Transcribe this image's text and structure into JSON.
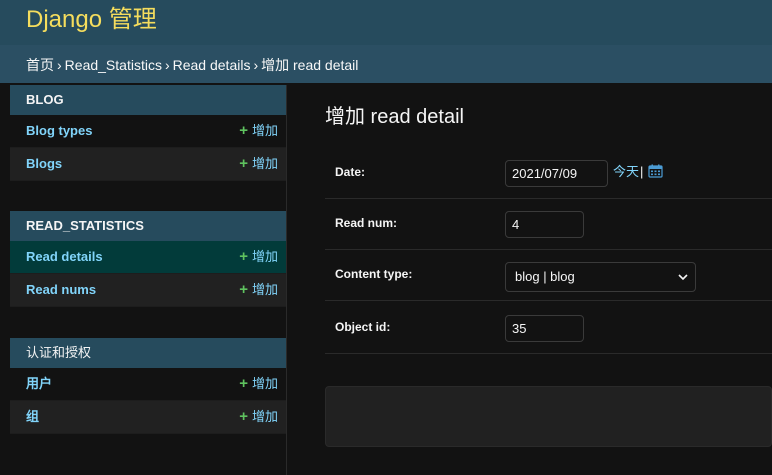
{
  "header": {
    "brand": "Django 管理"
  },
  "breadcrumbs": {
    "home": "首页",
    "app": "Read_Statistics",
    "model": "Read details",
    "current": "增加 read detail",
    "sep": "›"
  },
  "sidebar": {
    "modules": [
      {
        "caption": "BLOG",
        "items": [
          {
            "label": "Blog types",
            "add": "增加"
          },
          {
            "label": "Blogs",
            "add": "增加"
          }
        ]
      },
      {
        "caption": "READ_STATISTICS",
        "items": [
          {
            "label": "Read details",
            "add": "增加"
          },
          {
            "label": "Read nums",
            "add": "增加"
          }
        ]
      },
      {
        "caption": "认证和授权",
        "items": [
          {
            "label": "用户",
            "add": "增加"
          },
          {
            "label": "组",
            "add": "增加"
          }
        ]
      }
    ],
    "add_glyph": "+"
  },
  "content": {
    "title": "增加 read detail",
    "fields": {
      "date": {
        "label": "Date:",
        "value": "2021/07/09",
        "today": "今天",
        "bar": "|"
      },
      "read_num": {
        "label": "Read num:",
        "value": "4"
      },
      "content_type": {
        "label": "Content type:",
        "value": "blog | blog"
      },
      "object_id": {
        "label": "Object id:",
        "value": "35"
      }
    }
  },
  "colors": {
    "header": "#264b5d",
    "brand": "#f5dd5d",
    "link": "#81d4fa",
    "add_plus": "#5fc35f",
    "current_row": "#023b3a"
  },
  "icons": {
    "calendar": "calendar-icon",
    "select_chevron": "chevron-down-icon",
    "add": "plus-icon"
  }
}
